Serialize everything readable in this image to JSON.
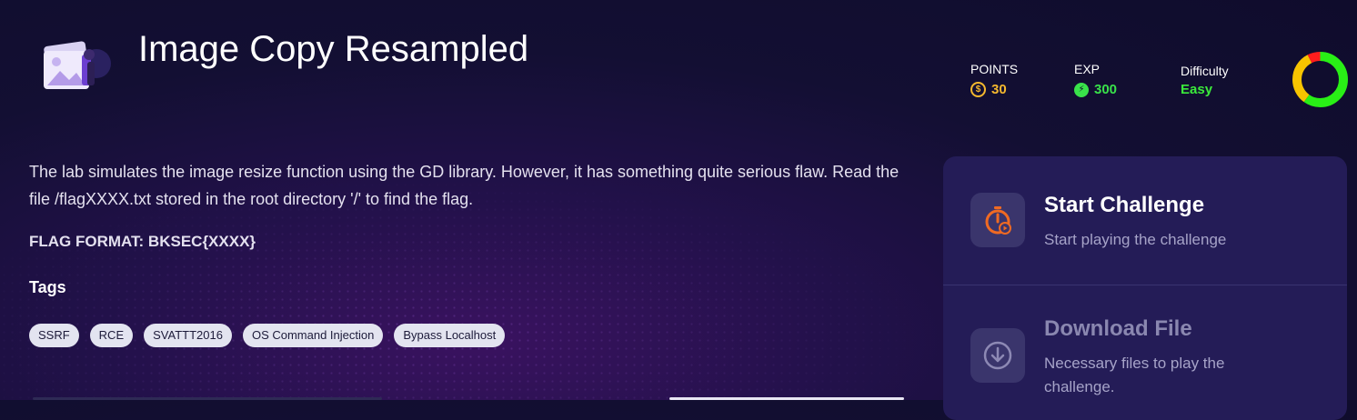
{
  "challenge": {
    "title": "Image Copy Resampled",
    "description": "The lab simulates the image resize function using the GD library. However, it has something quite serious flaw. Read the file /flagXXXX.txt stored in the root directory '/' to find the flag.",
    "flag_format": "FLAG FORMAT: BKSEC{XXXX}",
    "tags_title": "Tags",
    "tags": [
      "SSRF",
      "RCE",
      "SVATTT2016",
      "OS Command Injection",
      "Bypass Localhost"
    ]
  },
  "stats": {
    "points_label": "POINTS",
    "points_value": "30",
    "exp_label": "EXP",
    "exp_value": "300",
    "difficulty_label": "Difficulty",
    "difficulty_value": "Easy"
  },
  "actions": {
    "start_title": "Start Challenge",
    "start_sub": "Start playing the challenge",
    "download_title": "Download File",
    "download_sub": "Necessary files to play the challenge."
  },
  "colors": {
    "points": "#f5b82e",
    "exp": "#39e24a",
    "easy": "#3bea3b",
    "start_icon": "#f06a22",
    "donut_green": "#29ef16",
    "donut_yellow": "#f7c400",
    "donut_red": "#ff1d1d"
  }
}
